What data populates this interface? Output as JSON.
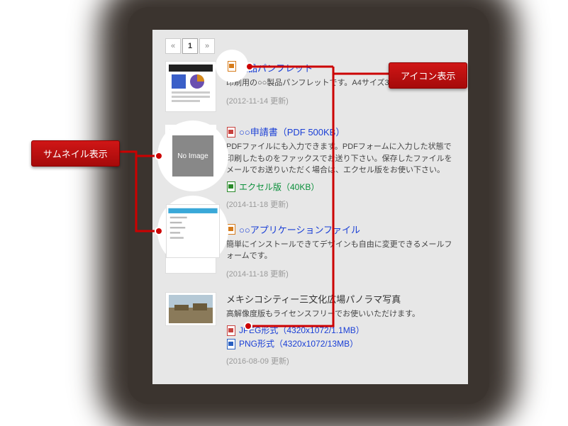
{
  "pager": {
    "prev": "«",
    "current": "1",
    "next": "»"
  },
  "items": [
    {
      "title": "製品パンフレット",
      "desc": "印刷用の○○製品パンフレットです。A4サイズ3ページ。",
      "updated": "(2012-11-14 更新)"
    },
    {
      "title": "○○申請書（PDF 500KB）",
      "desc": "PDFファイルにも入力できます。PDFフォームに入力した状態で印刷したものをファックスでお送り下さい。保存したファイルをメールでお送りいただく場合は、エクセル版をお使い下さい。",
      "extraLabel": "エクセル版（40KB）",
      "updated": "(2014-11-18 更新)",
      "noimgText": "No Image"
    },
    {
      "title": "○○アプリケーションファイル",
      "desc": "簡単にインストールできてデザインも自由に変更できるメールフォームです。",
      "updated": "(2014-11-18 更新)"
    },
    {
      "plainTitle": "メキシコシティー三文化広場パノラマ写真",
      "desc": "高解像度版もライセンスフリーでお使いいただけます。",
      "link1": "JPEG形式（4320x1072/1.1MB）",
      "link2": "PNG形式（4320x1072/13MB）",
      "updated": "(2016-08-09 更新)"
    }
  ],
  "callouts": {
    "thumbnail": "サムネイル表示",
    "icon": "アイコン表示"
  }
}
